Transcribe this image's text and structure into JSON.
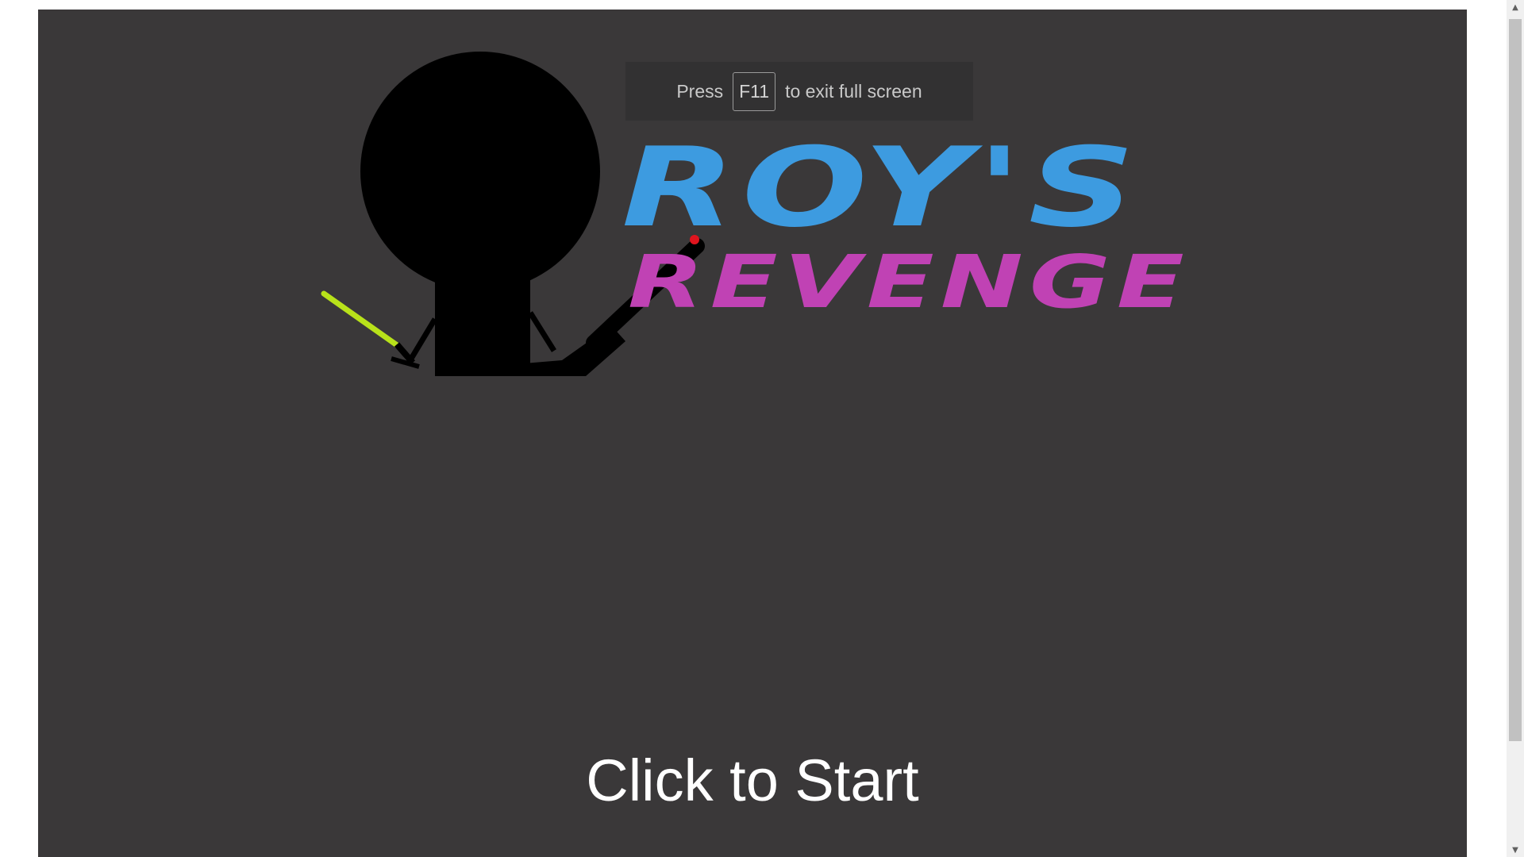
{
  "game": {
    "title_line1": "ROY'S",
    "title_line2": "REVENGE",
    "start_prompt": "Click to Start"
  },
  "fullscreen_notice": {
    "before": "Press",
    "key": "F11",
    "after": "to exit full screen"
  },
  "colors": {
    "canvas_bg": "#3a3839",
    "title_line1": "#3d9be0",
    "title_line2": "#c042b4",
    "saber_blade": "#b8e21a",
    "saber_tip": "#e0141e"
  },
  "icons": {
    "scroll_up": "▲",
    "scroll_down": "▼"
  }
}
